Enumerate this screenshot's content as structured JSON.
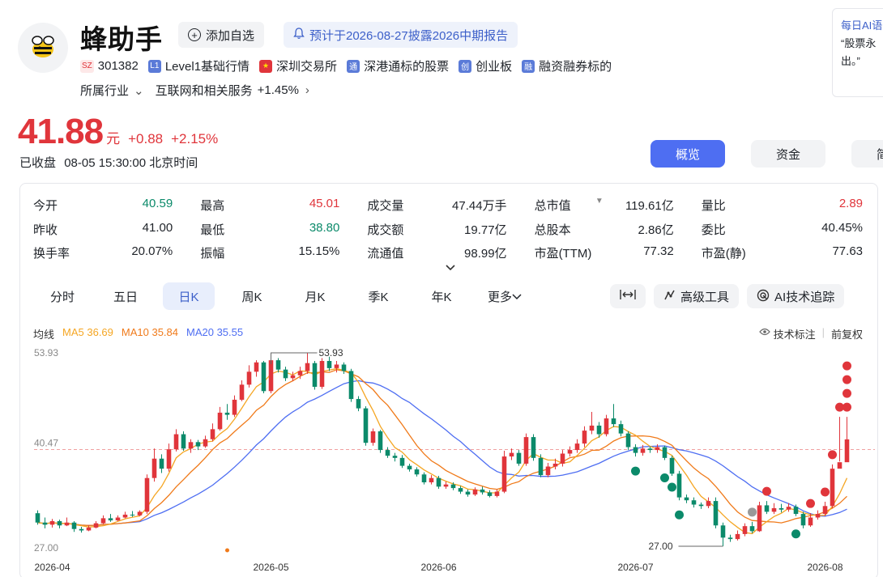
{
  "stock": {
    "name": "蜂助手",
    "add_label": "添加自选",
    "report_notice": "预计于2026-08-27披露2026中期报告",
    "market_code": "SZ",
    "code": "301382",
    "tags": [
      {
        "icon": "L1",
        "label": "Level1基础行情"
      },
      {
        "icon": "flag",
        "label": "深圳交易所"
      },
      {
        "icon": "通",
        "label": "深港通标的股票"
      },
      {
        "icon": "创",
        "label": "创业板"
      },
      {
        "icon": "融",
        "label": "融资融券标的"
      }
    ],
    "industry_label": "所属行业",
    "industry_name": "互联网和相关服务",
    "industry_change": "+1.45%"
  },
  "ai_box": {
    "title": "每日AI语",
    "line1": "“股票永",
    "line2": "出。”"
  },
  "quote": {
    "price": "41.88",
    "unit": "元",
    "change": "+0.88",
    "change_pct": "+2.15%",
    "status": "已收盘",
    "time": "08-05 15:30:00 北京时间"
  },
  "right_tabs": [
    "概览",
    "资金",
    "简况"
  ],
  "stats": [
    [
      {
        "k": "今开",
        "v": "40.59",
        "c": "down"
      },
      {
        "k": "最高",
        "v": "45.01",
        "c": "up"
      },
      {
        "k": "成交量",
        "v": "47.44万手",
        "c": "flat"
      },
      {
        "k": "总市值",
        "v": "119.61亿",
        "c": "flat",
        "caret": true
      },
      {
        "k": "量比",
        "v": "2.89",
        "c": "up"
      }
    ],
    [
      {
        "k": "昨收",
        "v": "41.00",
        "c": "flat"
      },
      {
        "k": "最低",
        "v": "38.80",
        "c": "down"
      },
      {
        "k": "成交额",
        "v": "19.77亿",
        "c": "flat"
      },
      {
        "k": "总股本",
        "v": "2.86亿",
        "c": "flat"
      },
      {
        "k": "委比",
        "v": "40.45%",
        "c": "flat"
      }
    ],
    [
      {
        "k": "换手率",
        "v": "20.07%",
        "c": "flat"
      },
      {
        "k": "振幅",
        "v": "15.15%",
        "c": "flat"
      },
      {
        "k": "流通值",
        "v": "98.99亿",
        "c": "flat"
      },
      {
        "k": "市盈(TTM)",
        "v": "77.32",
        "c": "flat"
      },
      {
        "k": "市盈(静)",
        "v": "77.63",
        "c": "flat"
      }
    ]
  ],
  "kline_tabs": [
    "分时",
    "五日",
    "日K",
    "周K",
    "月K",
    "季K",
    "年K",
    "更多"
  ],
  "tools": {
    "fit": "",
    "advanced": "高级工具",
    "ai_track": "AI技术追踪"
  },
  "legend": {
    "label": "均线",
    "ma5": "MA5 36.69",
    "ma10": "MA10 35.84",
    "ma20": "MA20 35.55",
    "tech": "技术标注",
    "adjust": "前复权"
  },
  "colors": {
    "up": "#e0353b",
    "down": "#0b8a6a",
    "ma5": "#f5a623",
    "ma10": "#f07a1a",
    "ma20": "#4e6ef2",
    "accent": "#4e6ef2"
  },
  "chart_data": {
    "type": "candlestick",
    "y_ticks": [
      "53.93",
      "40.47",
      "27.00"
    ],
    "ylim": [
      27.0,
      53.93
    ],
    "x_ticks": [
      "2026-04",
      "2026-05",
      "2026-06",
      "2026-07",
      "2026-08"
    ],
    "high_label": "53.93",
    "low_label": "27.00",
    "reference_price": 40.47,
    "candles": [
      [
        31.6,
        30.3,
        32.0,
        30.0
      ],
      [
        30.3,
        30.0,
        31.0,
        29.5
      ],
      [
        30.0,
        30.5,
        30.8,
        29.6
      ],
      [
        30.5,
        29.9,
        30.7,
        29.5
      ],
      [
        29.9,
        30.3,
        31.0,
        29.8
      ],
      [
        30.3,
        29.4,
        30.5,
        29.0
      ],
      [
        29.4,
        29.2,
        29.7,
        28.9
      ],
      [
        29.2,
        29.6,
        29.9,
        29.1
      ],
      [
        29.6,
        30.2,
        30.5,
        29.5
      ],
      [
        30.2,
        30.9,
        31.3,
        30.1
      ],
      [
        30.9,
        30.6,
        31.5,
        30.4
      ],
      [
        30.6,
        31.0,
        31.3,
        30.5
      ],
      [
        31.0,
        31.4,
        31.8,
        30.9
      ],
      [
        31.4,
        31.3,
        31.9,
        31.1
      ],
      [
        31.3,
        31.8,
        32.0,
        31.2
      ],
      [
        31.8,
        36.5,
        37.0,
        31.5
      ],
      [
        36.5,
        39.2,
        40.6,
        36.0
      ],
      [
        39.2,
        37.8,
        39.8,
        37.2
      ],
      [
        37.8,
        40.5,
        41.3,
        37.4
      ],
      [
        40.5,
        42.6,
        43.3,
        40.2
      ],
      [
        42.6,
        40.6,
        43.0,
        40.3
      ],
      [
        40.6,
        41.5,
        41.9,
        40.0
      ],
      [
        41.5,
        40.9,
        41.8,
        40.4
      ],
      [
        40.9,
        41.9,
        42.4,
        40.7
      ],
      [
        41.9,
        43.3,
        44.1,
        41.6
      ],
      [
        43.3,
        45.6,
        46.4,
        43.1
      ],
      [
        45.6,
        45.3,
        46.8,
        44.6
      ],
      [
        45.3,
        47.4,
        48.0,
        45.0
      ],
      [
        47.4,
        49.5,
        50.1,
        47.2
      ],
      [
        49.5,
        51.3,
        52.2,
        49.1
      ],
      [
        51.3,
        52.6,
        52.9,
        50.6
      ],
      [
        52.6,
        48.6,
        52.8,
        48.3
      ],
      [
        48.6,
        52.9,
        53.4,
        48.3
      ],
      [
        52.9,
        51.6,
        53.2,
        51.2
      ],
      [
        51.6,
        50.4,
        52.0,
        50.0
      ],
      [
        50.4,
        50.8,
        51.3,
        50.0
      ],
      [
        50.8,
        51.4,
        52.0,
        50.3
      ],
      [
        51.4,
        52.5,
        53.93,
        51.0
      ],
      [
        52.5,
        49.2,
        52.8,
        48.8
      ],
      [
        49.2,
        52.8,
        53.2,
        48.9
      ],
      [
        52.8,
        51.8,
        53.4,
        51.4
      ],
      [
        51.8,
        52.3,
        52.8,
        51.2
      ],
      [
        52.3,
        51.4,
        52.6,
        51.0
      ],
      [
        51.4,
        47.5,
        51.7,
        47.1
      ],
      [
        47.5,
        46.2,
        47.9,
        45.8
      ],
      [
        46.2,
        41.4,
        46.5,
        41.0
      ],
      [
        41.4,
        43.0,
        43.4,
        41.0
      ],
      [
        43.0,
        40.4,
        43.2,
        40.0
      ],
      [
        40.4,
        39.6,
        40.8,
        39.3
      ],
      [
        39.6,
        39.3,
        40.0,
        38.8
      ],
      [
        39.3,
        38.2,
        39.7,
        37.9
      ],
      [
        38.2,
        37.7,
        38.5,
        37.4
      ],
      [
        37.7,
        37.0,
        38.0,
        36.7
      ],
      [
        37.0,
        35.9,
        37.3,
        35.6
      ],
      [
        35.9,
        36.5,
        36.9,
        35.6
      ],
      [
        36.5,
        35.3,
        36.8,
        35.0
      ],
      [
        35.3,
        35.6,
        36.0,
        35.0
      ],
      [
        35.6,
        35.1,
        35.9,
        34.8
      ],
      [
        35.1,
        34.6,
        35.4,
        34.3
      ],
      [
        34.6,
        34.2,
        34.9,
        33.9
      ],
      [
        34.2,
        34.9,
        35.2,
        34.0
      ],
      [
        34.9,
        34.5,
        35.3,
        34.2
      ],
      [
        34.5,
        34.0,
        34.8,
        33.8
      ],
      [
        34.0,
        34.6,
        34.9,
        33.8
      ],
      [
        34.6,
        39.5,
        40.3,
        34.4
      ],
      [
        39.5,
        40.0,
        40.6,
        39.0
      ],
      [
        40.0,
        38.5,
        40.4,
        38.2
      ],
      [
        38.5,
        42.2,
        42.7,
        38.2
      ],
      [
        42.2,
        39.3,
        42.6,
        38.9
      ],
      [
        39.3,
        36.9,
        39.8,
        36.6
      ],
      [
        36.9,
        38.1,
        38.6,
        36.6
      ],
      [
        38.1,
        38.5,
        39.2,
        37.7
      ],
      [
        38.5,
        39.9,
        40.4,
        38.1
      ],
      [
        39.9,
        40.4,
        40.9,
        39.5
      ],
      [
        40.4,
        41.3,
        41.9,
        40.0
      ],
      [
        41.3,
        43.1,
        43.7,
        40.8
      ],
      [
        43.1,
        43.8,
        45.7,
        42.6
      ],
      [
        43.8,
        42.6,
        44.3,
        42.1
      ],
      [
        42.6,
        44.8,
        45.3,
        42.3
      ],
      [
        44.8,
        44.0,
        46.8,
        43.6
      ],
      [
        44.0,
        42.7,
        44.5,
        42.3
      ],
      [
        42.7,
        40.8,
        43.0,
        40.4
      ],
      [
        40.8,
        40.0,
        41.2,
        39.5
      ],
      [
        40.0,
        40.6,
        41.1,
        39.6
      ],
      [
        40.6,
        40.4,
        40.9,
        40.0
      ],
      [
        40.4,
        40.8,
        41.2,
        40.0
      ],
      [
        40.8,
        39.3,
        41.0,
        39.0
      ],
      [
        39.3,
        37.1,
        39.6,
        36.8
      ],
      [
        37.1,
        33.8,
        37.5,
        33.4
      ],
      [
        33.8,
        33.4,
        34.2,
        33.0
      ],
      [
        33.4,
        32.8,
        33.8,
        32.4
      ],
      [
        32.8,
        32.6,
        33.1,
        32.2
      ],
      [
        32.6,
        33.3,
        33.8,
        32.3
      ],
      [
        33.3,
        29.9,
        33.8,
        29.5
      ],
      [
        29.9,
        28.2,
        30.3,
        27.0
      ],
      [
        28.2,
        28.0,
        28.6,
        27.6
      ],
      [
        28.0,
        28.7,
        29.2,
        27.8
      ],
      [
        28.7,
        29.8,
        30.2,
        28.4
      ],
      [
        29.8,
        29.1,
        30.4,
        28.8
      ],
      [
        29.1,
        32.7,
        33.2,
        29.0
      ],
      [
        32.7,
        31.8,
        33.3,
        31.5
      ],
      [
        31.8,
        32.3,
        33.0,
        31.5
      ],
      [
        32.3,
        32.1,
        32.9,
        31.7
      ],
      [
        32.1,
        32.5,
        33.0,
        31.8
      ],
      [
        32.5,
        31.5,
        32.8,
        31.2
      ],
      [
        31.5,
        29.9,
        31.8,
        29.5
      ],
      [
        29.9,
        31.0,
        31.6,
        29.7
      ],
      [
        31.0,
        31.5,
        32.0,
        30.7
      ],
      [
        31.5,
        32.6,
        33.2,
        31.2
      ],
      [
        32.6,
        37.8,
        38.4,
        32.3
      ],
      [
        37.8,
        38.7,
        45.01,
        38.8
      ],
      [
        38.7,
        41.88,
        45.01,
        38.8
      ]
    ]
  }
}
